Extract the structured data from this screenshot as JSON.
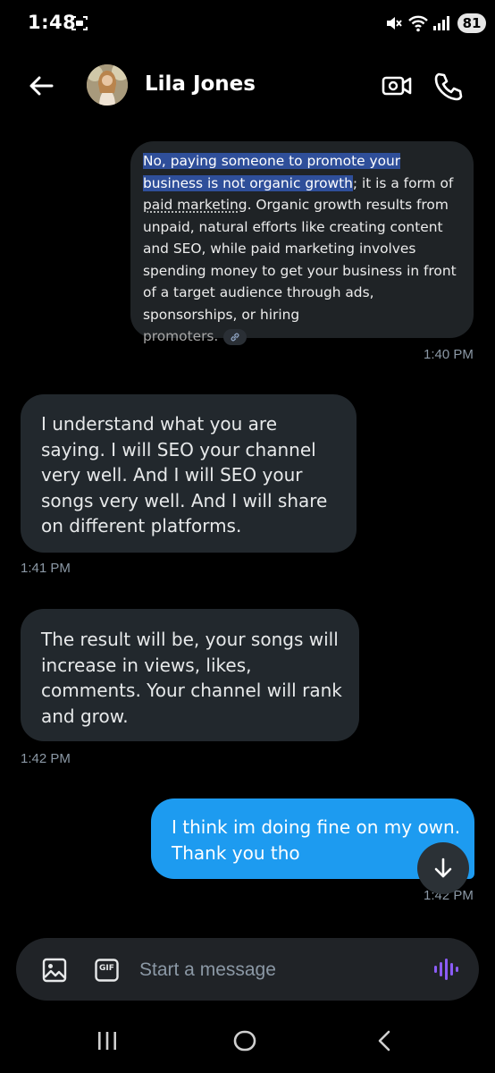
{
  "status_bar": {
    "time": "1:48",
    "battery": "81",
    "icons": [
      "screenshot-icon",
      "mute-icon",
      "wifi-icon",
      "signal-icon",
      "battery-icon"
    ]
  },
  "header": {
    "contact_name": "Lila Jones",
    "icons": [
      "back-arrow-icon",
      "avatar",
      "video-call-icon",
      "phone-icon"
    ]
  },
  "messages": [
    {
      "direction": "outgoing",
      "kind": "ai-answer-quote",
      "highlight": "No, paying someone to promote your business is not organic growth",
      "part2": "; it is a form of ",
      "underlined": "paid marketing",
      "part3": ". Organic growth results from unpaid, natural efforts like creating content and SEO, while paid marketing involves spending money to get your business in front of a target audience through ads, sponsorships, or hiring",
      "tail": "promoters.",
      "time": "1:40 PM"
    },
    {
      "direction": "incoming",
      "text": "I understand what you are saying. I will SEO your channel very well. And I will SEO your songs very well. And I will share on different platforms.",
      "time": "1:41 PM"
    },
    {
      "direction": "incoming",
      "text": "The result will be, your songs will increase in views, likes, comments. Your channel will rank and grow.",
      "time": "1:42 PM"
    },
    {
      "direction": "outgoing",
      "text": "I think im doing fine on my own. Thank you tho",
      "time": "1:42 PM"
    }
  ],
  "composer": {
    "placeholder": "Start a message",
    "gif_label": "GIF",
    "icons": [
      "image-icon",
      "gif-icon",
      "voice-icon"
    ]
  },
  "colors": {
    "background": "#000000",
    "incoming_bubble": "#22282d",
    "outgoing_bubble": "#1d9bf0",
    "highlight": "#2f4f9a",
    "timestamp": "#8b98a5",
    "voice_accent": "#8b5cf6"
  }
}
